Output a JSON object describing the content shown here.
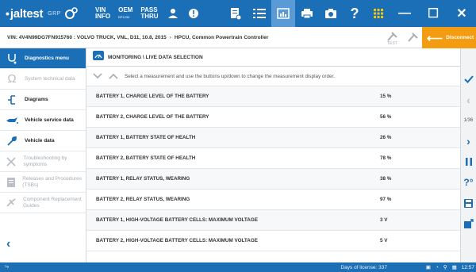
{
  "topbar": {
    "logo": "jaltest",
    "logo_sub": "GRP",
    "vin_info_top": "VIN",
    "vin_info_bottom": "INFO",
    "oem_top": "OEM",
    "oem_bottom": "BP1230",
    "pass_top": "PASS",
    "pass_bottom": "THRU",
    "help": "?",
    "minimize": "—",
    "maximize": "☐",
    "close": "✕"
  },
  "infobar": {
    "vin_line": "VIN: 4V4N99DG7FN915760 : VOLVO TRUCK, VNL, D11, 10.8, 2015",
    "separator": "›",
    "module": "HPCU, Common Powertrain Controller",
    "disconnect": "Disconnect"
  },
  "sidebar": {
    "items": [
      {
        "label": "Diagnostics menu",
        "state": "active",
        "icon": "stethoscope-icon"
      },
      {
        "label": "System technical data",
        "state": "disabled",
        "icon": "ohm-icon"
      },
      {
        "label": "Diagrams",
        "state": "normal",
        "icon": "diagram-icon"
      },
      {
        "label": "Vehicle service data",
        "state": "normal",
        "icon": "oil-can-icon"
      },
      {
        "label": "Vehicle data",
        "state": "normal",
        "icon": "wrench-icon"
      },
      {
        "label": "Troubleshooting by symptoms",
        "state": "disabled",
        "icon": "tools-icon"
      },
      {
        "label": "Releases and Procedures (TSBs)",
        "state": "disabled",
        "icon": "document-icon"
      },
      {
        "label": "Component Replacement Guides",
        "state": "disabled",
        "icon": "replace-icon"
      }
    ]
  },
  "main": {
    "title": "MONITORING \\ LIVE DATA SELECTION",
    "instruction": "Select a measurement and use the buttons up/down to change the measurement display order.",
    "rows": [
      {
        "name": "BATTERY 1, CHARGE LEVEL OF THE BATTERY",
        "value": "15 %"
      },
      {
        "name": "BATTERY 2, CHARGE LEVEL OF THE BATTERY",
        "value": "56 %"
      },
      {
        "name": "BATTERY 1, BATTERY STATE OF HEALTH",
        "value": "26 %"
      },
      {
        "name": "BATTERY 2, BATTERY STATE OF HEALTH",
        "value": "78 %"
      },
      {
        "name": "BATTERY 1, RELAY STATUS, WEARING",
        "value": "38 %"
      },
      {
        "name": "BATTERY 2, RELAY STATUS, WEARING",
        "value": "97 %"
      },
      {
        "name": "BATTERY 1, HIGH-VOLTAGE BATTERY CELLS: MAXIMUM VOLTAGE",
        "value": "3 V"
      },
      {
        "name": "BATTERY 2, HIGH-VOLTAGE BATTERY CELLS: MAXIMUM VOLTAGE",
        "value": "5 V"
      }
    ]
  },
  "rightbar": {
    "page": "1/36"
  },
  "statusbar": {
    "license": "Days of license: 337",
    "time": "12:57"
  },
  "colors": {
    "brand": "#1b6fb7",
    "accent": "#f39c12"
  }
}
